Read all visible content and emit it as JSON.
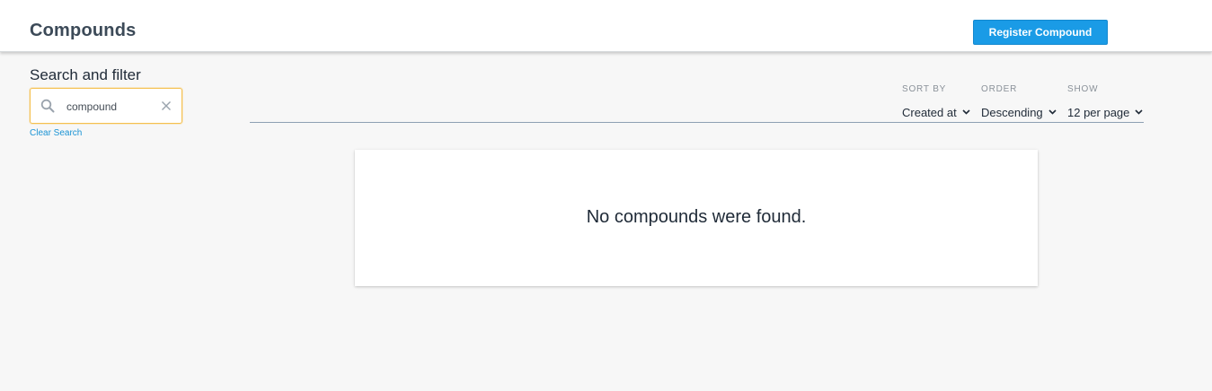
{
  "header": {
    "title": "Compounds",
    "register_button": "Register Compound"
  },
  "filter": {
    "title": "Search and filter",
    "search_value": "compound",
    "clear_search": "Clear Search"
  },
  "sorting": {
    "sort_by_label": "SORT BY",
    "sort_by_value": "Created at",
    "order_label": "ORDER",
    "order_value": "Descending",
    "show_label": "SHOW",
    "show_value": "12 per page"
  },
  "results": {
    "empty_message": "No compounds were found."
  },
  "colors": {
    "accent": "#1a9be6",
    "search_focus": "#f5c04e",
    "link": "#1a93d4"
  },
  "icons": {
    "search": "search-icon",
    "clear": "close-icon",
    "dropdown": "chevron-down-icon"
  }
}
